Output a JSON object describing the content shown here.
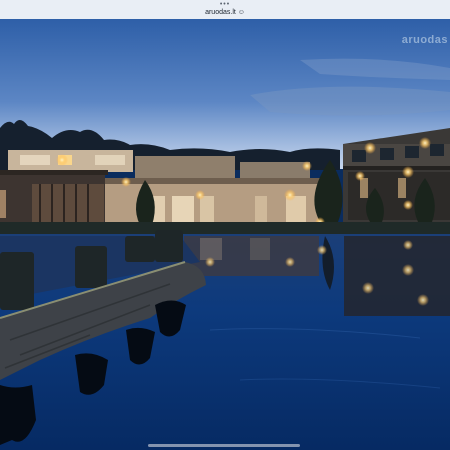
{
  "browser": {
    "dots": "•••",
    "url": "aruodas.lt ☺"
  },
  "photo": {
    "watermark": "aruodas",
    "sky_color": "#3f6fb4",
    "water_color": "#0b3472",
    "light_color": "#ffd27a"
  },
  "icons": {
    "home_indicator": "home-indicator-bar"
  }
}
